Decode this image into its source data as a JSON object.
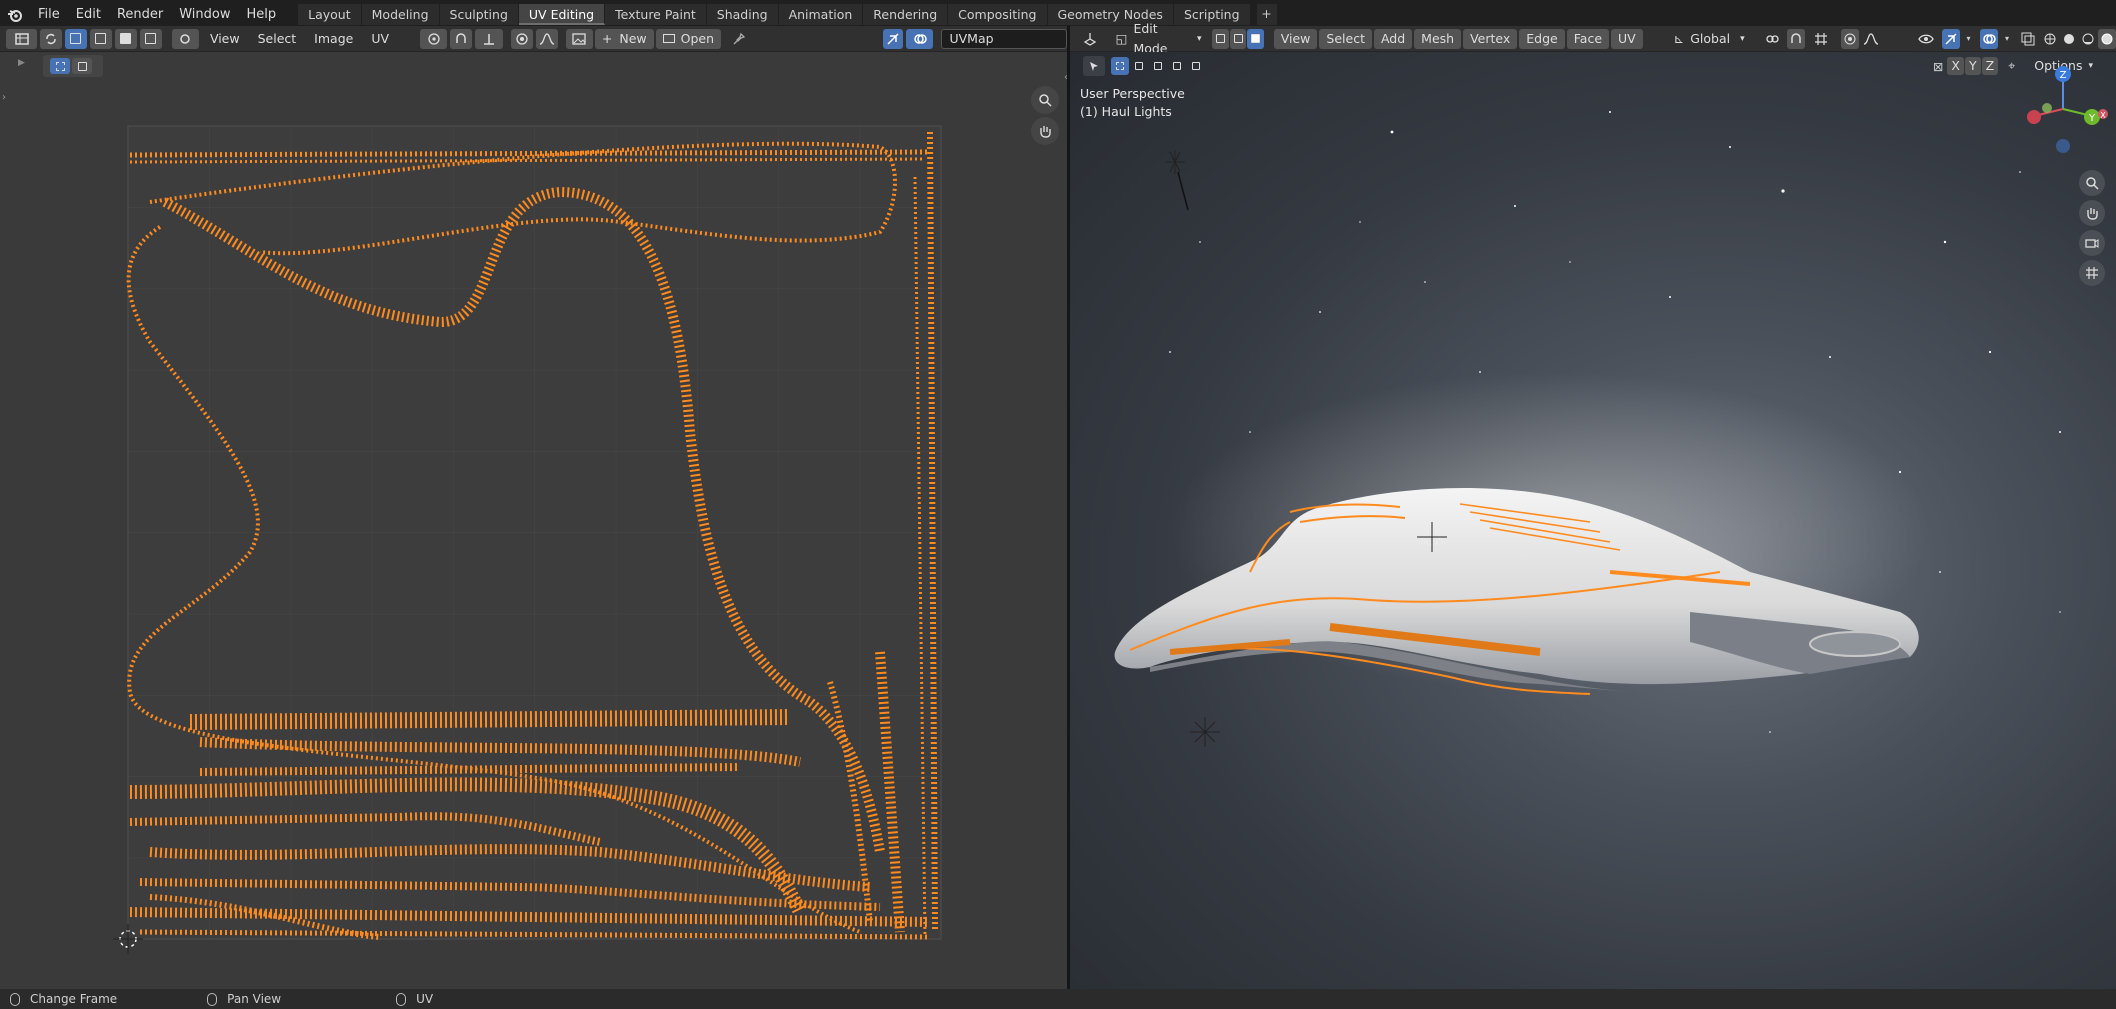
{
  "topbar": {
    "menus": [
      "File",
      "Edit",
      "Render",
      "Window",
      "Help"
    ],
    "workspaces": [
      "Layout",
      "Modeling",
      "Sculpting",
      "UV Editing",
      "Texture Paint",
      "Shading",
      "Animation",
      "Rendering",
      "Compositing",
      "Geometry Nodes",
      "Scripting"
    ],
    "active_workspace": "UV Editing",
    "add_label": "+"
  },
  "uv_editor": {
    "menus": [
      "View",
      "Select",
      "Image",
      "UV"
    ],
    "new_label": "New",
    "open_label": "Open",
    "uvmap_value": "UVMap"
  },
  "viewport": {
    "mode_label": "Edit Mode",
    "menus": [
      "View",
      "Select",
      "Add",
      "Mesh",
      "Vertex",
      "Edge",
      "Face",
      "UV"
    ],
    "transform_orientation": "Global",
    "perspective_label": "User Perspective",
    "object_label": "(1) Haul Lights",
    "axis_buttons": [
      "X",
      "Y",
      "Z"
    ],
    "options_label": "Options",
    "gizmo": {
      "z": "Z",
      "y": "Y",
      "x": "X"
    }
  },
  "status": {
    "items": [
      "Change Frame",
      "Pan View",
      "UV"
    ]
  },
  "colors": {
    "accent": "#4772b3",
    "uv_edge": "#ff8a1e",
    "selection": "#ff8a1e"
  }
}
